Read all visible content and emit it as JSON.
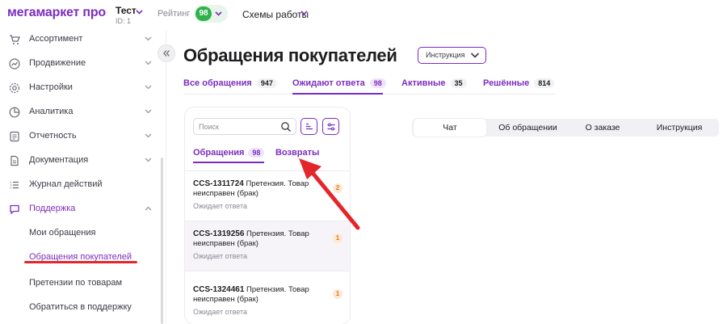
{
  "header": {
    "logo": "мегамаркет про",
    "account_name": "Тест",
    "account_id": "ID: 1",
    "rating_label": "Рейтинг",
    "rating_value": "98",
    "schemes_label": "Схемы работы"
  },
  "sidebar": {
    "items": [
      {
        "label": "Ассортимент",
        "icon": "cart-icon"
      },
      {
        "label": "Продвижение",
        "icon": "growth-icon"
      },
      {
        "label": "Настройки",
        "icon": "gear-icon"
      },
      {
        "label": "Аналитика",
        "icon": "pie-chart-icon"
      },
      {
        "label": "Отчетность",
        "icon": "report-icon"
      },
      {
        "label": "Документация",
        "icon": "document-icon"
      },
      {
        "label": "Журнал действий",
        "icon": "list-icon"
      },
      {
        "label": "Поддержка",
        "icon": "chat-icon"
      }
    ],
    "support_subitems": [
      {
        "label": "Мои обращения"
      },
      {
        "label": "Обращения покупателей"
      },
      {
        "label": "Претензии по товарам"
      },
      {
        "label": "Обратиться в поддержку"
      }
    ]
  },
  "main": {
    "title": "Обращения покупателей",
    "instruction_button": "Инструкция",
    "tabs": [
      {
        "label": "Все обращения",
        "count": "947"
      },
      {
        "label": "Ожидают ответа",
        "count": "98"
      },
      {
        "label": "Активные",
        "count": "35"
      },
      {
        "label": "Решённые",
        "count": "814"
      }
    ],
    "search_placeholder": "Поиск",
    "subtabs": [
      {
        "label": "Обращения",
        "count": "98"
      },
      {
        "label": "Возвраты"
      }
    ],
    "tickets": [
      {
        "id": "CCS-1311724",
        "text": "Претензия. Товар неисправен (брак)",
        "status": "Ожидает ответа",
        "badge": "2"
      },
      {
        "id": "CCS-1319256",
        "text": "Претензия. Товар неисправен (брак)",
        "status": "Ожидает ответа",
        "badge": "1"
      },
      {
        "id": "CCS-1324461",
        "text": "Претензия. Товар неисправен (брак)",
        "status": "Ожидает ответа",
        "badge": "1"
      }
    ],
    "detail_tabs": [
      "Чат",
      "Об обращении",
      "О заказе",
      "Инструкция"
    ]
  },
  "colors": {
    "accent": "#7b2cbf",
    "rating_green": "#2fb24c",
    "annotation_red": "#e3262a",
    "badge_orange": "#e07a1a"
  }
}
